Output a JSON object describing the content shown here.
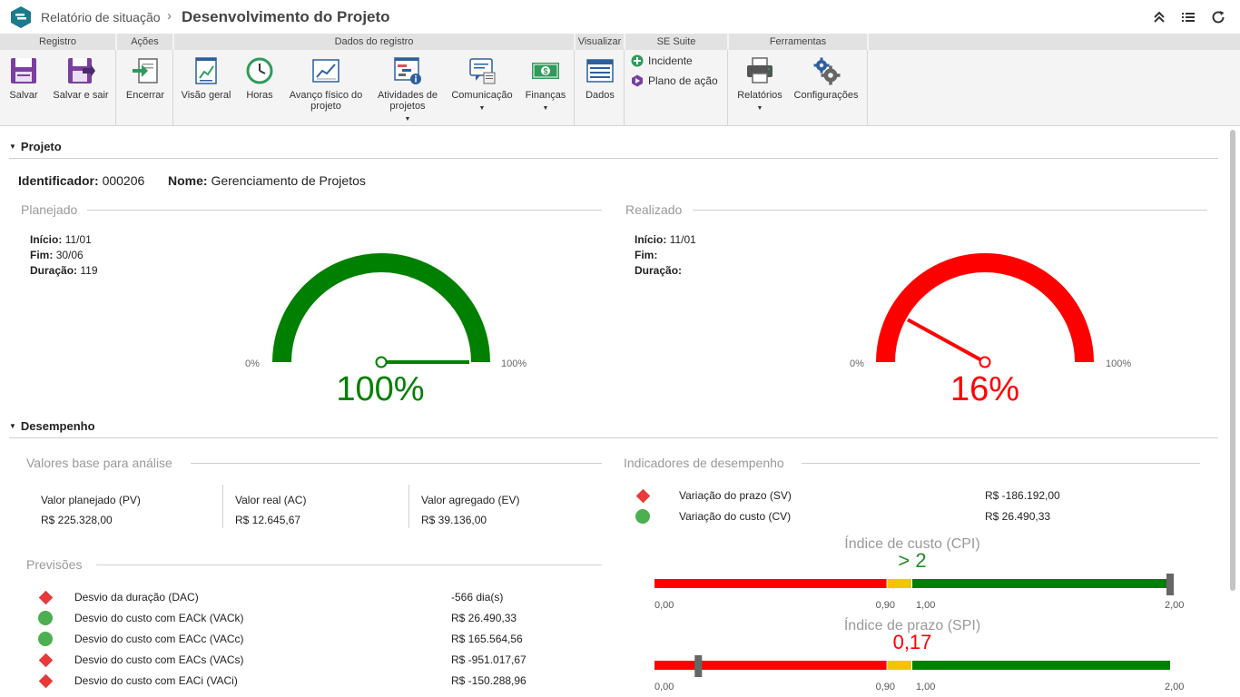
{
  "header": {
    "breadcrumb": "Relatório de situação",
    "separator": "›",
    "title": "Desenvolvimento do Projeto",
    "icons": [
      "collapse-icon",
      "list-icon",
      "refresh-icon"
    ]
  },
  "ribbon": {
    "groups": [
      {
        "label": "Registro"
      },
      {
        "label": "Ações"
      },
      {
        "label": "Dados do registro"
      },
      {
        "label": "Visualizar"
      },
      {
        "label": "SE Suite"
      },
      {
        "label": "Ferramentas"
      }
    ],
    "buttons": {
      "save": "Salvar",
      "save_exit": "Salvar e sair",
      "close": "Encerrar",
      "overview": "Visão geral",
      "hours": "Horas",
      "progress": "Avanço físico do projeto",
      "activities": "Atividades de projetos",
      "communication": "Comunicação",
      "finance": "Finanças",
      "data": "Dados",
      "incident": "Incidente",
      "action_plan": "Plano de ação",
      "reports": "Relatórios",
      "settings": "Configurações"
    },
    "colors": {
      "purple": "#7b3fa0",
      "green": "#2e9b5a",
      "blue": "#2d5f9e"
    }
  },
  "project": {
    "section_title": "Projeto",
    "identifier_label": "Identificador:",
    "identifier_value": "000206",
    "name_label": "Nome:",
    "name_value": "Gerenciamento de Projetos",
    "planned": {
      "title": "Planejado",
      "start_label": "Início:",
      "start_value": "11/01",
      "end_label": "Fim:",
      "end_value": "30/06",
      "duration_label": "Duração:",
      "duration_value": "119",
      "gauge_min": "0%",
      "gauge_max": "100%",
      "percent_text": "100%",
      "percent": 100,
      "color": "#008000"
    },
    "actual": {
      "title": "Realizado",
      "start_label": "Início:",
      "start_value": "11/01",
      "end_label": "Fim:",
      "end_value": "",
      "duration_label": "Duração:",
      "duration_value": "",
      "gauge_min": "0%",
      "gauge_max": "100%",
      "percent_text": "16%",
      "percent": 16,
      "color": "#ff0000"
    }
  },
  "performance": {
    "section_title": "Desempenho",
    "base_values": {
      "title": "Valores base para análise",
      "items": [
        {
          "label": "Valor planejado (PV)",
          "value": "R$ 225.328,00"
        },
        {
          "label": "Valor real (AC)",
          "value": "R$ 12.645,67"
        },
        {
          "label": "Valor agregado (EV)",
          "value": "R$ 39.136,00"
        }
      ]
    },
    "forecasts": {
      "title": "Previsões",
      "items": [
        {
          "status": "diamond",
          "label": "Desvio da duração (DAC)",
          "value": "-566 dia(s)"
        },
        {
          "status": "circle",
          "label": "Desvio do custo com EACk (VACk)",
          "value": "R$ 26.490,33"
        },
        {
          "status": "circle",
          "label": "Desvio do custo com EACc (VACc)",
          "value": "R$ 165.564,56"
        },
        {
          "status": "diamond",
          "label": "Desvio do custo com EACs (VACs)",
          "value": "R$ -951.017,67"
        },
        {
          "status": "diamond",
          "label": "Desvio do custo com EACi (VACi)",
          "value": "R$ -150.288,96"
        }
      ]
    },
    "indicators": {
      "title": "Indicadores de desempenho",
      "items": [
        {
          "status": "diamond",
          "label": "Variação do prazo (SV)",
          "value": "R$ -186.192,00"
        },
        {
          "status": "circle",
          "label": "Variação do custo (CV)",
          "value": "R$ 26.490,33"
        }
      ]
    },
    "cpi": {
      "title": "Índice de custo (CPI)",
      "value_text": "> 2",
      "value": 2.0,
      "color": "#228b22",
      "ticks": [
        "0,00",
        "0,90",
        "1,00",
        "2,00"
      ]
    },
    "spi": {
      "title": "Índice de prazo (SPI)",
      "value_text": "0,17",
      "value": 0.17,
      "color": "#ff0000",
      "ticks": [
        "0,00",
        "0,90",
        "1,00",
        "2,00"
      ]
    },
    "status_colors": {
      "red": "#e83a3a",
      "green": "#4caf50",
      "yellow": "#f5c400",
      "bar_green": "#008000",
      "bar_red": "#ff0000"
    }
  }
}
